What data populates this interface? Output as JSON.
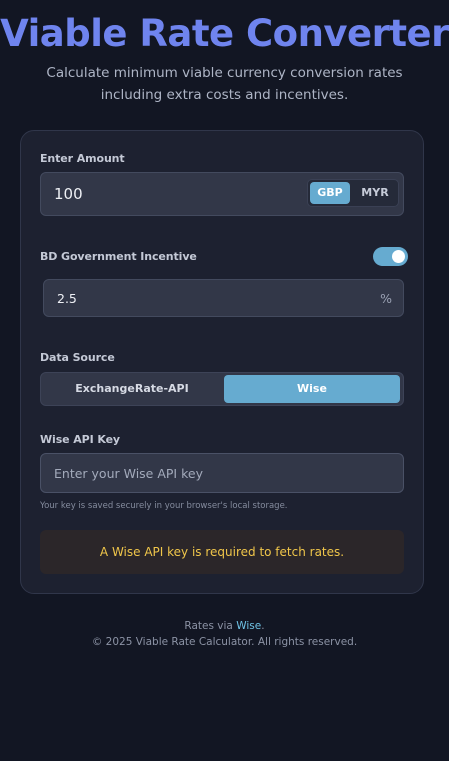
{
  "header": {
    "title": "Viable Rate Converter",
    "subtitle": "Calculate minimum viable currency conversion rates including extra costs and incentives."
  },
  "amount": {
    "label": "Enter Amount",
    "value": "100",
    "currencies": [
      "GBP",
      "MYR"
    ],
    "selected_currency": "GBP"
  },
  "incentive": {
    "label": "BD Government Incentive",
    "enabled": true,
    "value": "2.5",
    "suffix": "%"
  },
  "data_source": {
    "label": "Data Source",
    "options": [
      "ExchangeRate-API",
      "Wise"
    ],
    "selected": "Wise"
  },
  "api_key": {
    "label": "Wise API Key",
    "placeholder": "Enter your Wise API key",
    "hint": "Your key is saved securely in your browser's local storage."
  },
  "alert": {
    "message": "A Wise API key is required to fetch rates."
  },
  "footer": {
    "rates_prefix": "Rates via",
    "rates_link": "Wise",
    "rates_suffix": ".",
    "copyright": "© 2025 Viable Rate Calculator. All rights reserved."
  },
  "colors": {
    "background": "#121623",
    "accent": "#66abd0",
    "title": "#6f84ee",
    "warning": "#f0c64a"
  }
}
